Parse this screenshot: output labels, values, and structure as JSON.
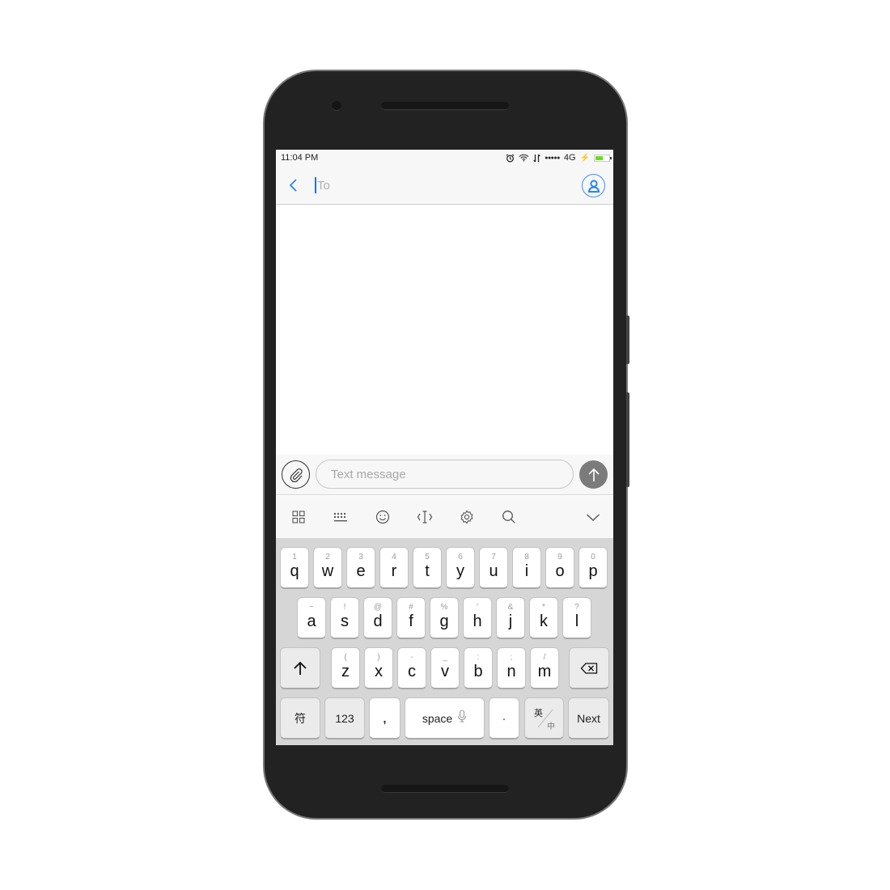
{
  "status_bar": {
    "time": "11:04 PM",
    "network": "4G",
    "signal_dots": "●●●●●",
    "battery_level": 0.55,
    "battery_color": "#6edc1c",
    "icons": [
      "alarm-icon",
      "wifi-icon",
      "data-arrows-icon",
      "signal-icon",
      "charging-icon",
      "battery-icon"
    ]
  },
  "header": {
    "back_icon": "chevron-left-icon",
    "to_placeholder": "To",
    "contact_icon": "person-icon",
    "accent_color": "#2c86e8"
  },
  "compose": {
    "attach_icon": "paperclip-icon",
    "placeholder": "Text message",
    "value": "",
    "send_icon": "arrow-up-icon"
  },
  "keyboard_toolbar": {
    "icons": [
      "apps-grid-icon",
      "keyboard-icon",
      "emoji-icon",
      "cursor-icon",
      "settings-icon",
      "search-icon",
      "collapse-chevron-icon"
    ]
  },
  "keyboard": {
    "row1": [
      {
        "main": "q",
        "sub": "1"
      },
      {
        "main": "w",
        "sub": "2"
      },
      {
        "main": "e",
        "sub": "3"
      },
      {
        "main": "r",
        "sub": "4"
      },
      {
        "main": "t",
        "sub": "5"
      },
      {
        "main": "y",
        "sub": "6"
      },
      {
        "main": "u",
        "sub": "7"
      },
      {
        "main": "i",
        "sub": "8"
      },
      {
        "main": "o",
        "sub": "9"
      },
      {
        "main": "p",
        "sub": "0"
      }
    ],
    "row2": [
      {
        "main": "a",
        "sub": "~"
      },
      {
        "main": "s",
        "sub": "!"
      },
      {
        "main": "d",
        "sub": "@"
      },
      {
        "main": "f",
        "sub": "#"
      },
      {
        "main": "g",
        "sub": "%"
      },
      {
        "main": "h",
        "sub": "'"
      },
      {
        "main": "j",
        "sub": "&"
      },
      {
        "main": "k",
        "sub": "*"
      },
      {
        "main": "l",
        "sub": "?"
      }
    ],
    "row3": [
      {
        "main": "z",
        "sub": "("
      },
      {
        "main": "x",
        "sub": ")"
      },
      {
        "main": "c",
        "sub": "-"
      },
      {
        "main": "v",
        "sub": "_"
      },
      {
        "main": "b",
        "sub": ":"
      },
      {
        "main": "n",
        "sub": ";"
      },
      {
        "main": "m",
        "sub": "/"
      }
    ],
    "shift_icon": "shift-arrow-icon",
    "backspace_icon": "backspace-icon",
    "symbols_label": "符",
    "numbers_label": "123",
    "comma_label": ",",
    "space_label": "space",
    "mic_icon": "microphone-icon",
    "period_label": "·",
    "lang_top": "英",
    "lang_bottom": "中",
    "next_label": "Next"
  }
}
